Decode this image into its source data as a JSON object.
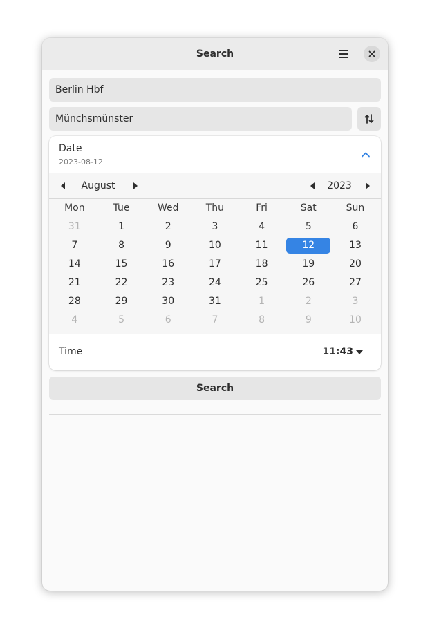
{
  "window": {
    "title": "Search"
  },
  "search": {
    "from_value": "Berlin Hbf",
    "to_value": "Münchsmünster",
    "button_label": "Search"
  },
  "date": {
    "label": "Date",
    "value": "2023-08-12"
  },
  "calendar": {
    "month": "August",
    "year": "2023",
    "weekdays": [
      "Mon",
      "Tue",
      "Wed",
      "Thu",
      "Fri",
      "Sat",
      "Sun"
    ],
    "weeks": [
      [
        "31",
        "1",
        "2",
        "3",
        "4",
        "5",
        "6"
      ],
      [
        "7",
        "8",
        "9",
        "10",
        "11",
        "12",
        "13"
      ],
      [
        "14",
        "15",
        "16",
        "17",
        "18",
        "19",
        "20"
      ],
      [
        "21",
        "22",
        "23",
        "24",
        "25",
        "26",
        "27"
      ],
      [
        "28",
        "29",
        "30",
        "31",
        "1",
        "2",
        "3"
      ],
      [
        "4",
        "5",
        "6",
        "7",
        "8",
        "9",
        "10"
      ]
    ],
    "selected_day": "12"
  },
  "time": {
    "label": "Time",
    "value": "11:43"
  },
  "colors": {
    "accent": "#3584e4",
    "headerbar": "#ebebeb",
    "entry_bg": "#e6e6e6"
  },
  "icons": {
    "menu": "hamburger-menu-icon",
    "close": "close-icon",
    "swap": "swap-arrows-icon",
    "expander": "chevron-up-icon",
    "prev": "triangle-left-icon",
    "next": "triangle-right-icon",
    "dropdown": "triangle-down-icon"
  }
}
